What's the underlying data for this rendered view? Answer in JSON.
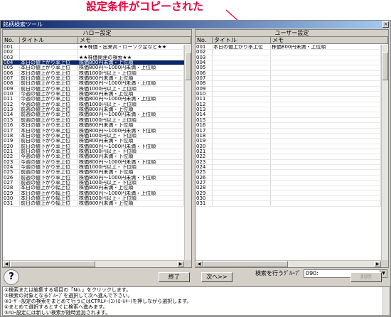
{
  "annotation": {
    "text": "設定条件がコピーされた"
  },
  "window": {
    "title": "銘柄検索ツール",
    "close_label": "×"
  },
  "left_pane": {
    "caption": "ハロー設定",
    "headers": {
      "no": "No.",
      "title": "タイトル",
      "memo": "メモ"
    },
    "rows": [
      {
        "no": "001",
        "title": "",
        "memo": "★★株価・出来高・ローソク足など★★"
      },
      {
        "no": "002",
        "title": "",
        "memo": ""
      },
      {
        "no": "003",
        "title": "",
        "memo": "★★株価関連の検索★★"
      },
      {
        "no": "004",
        "title": "本日の値上がり率上位",
        "memo": "株価800円未満・上位順",
        "sel": true
      },
      {
        "no": "005",
        "title": "本日の値上がり率上位",
        "memo": "株価800円～1000円未満・上位順"
      },
      {
        "no": "006",
        "title": "本日の値上がり率上位",
        "memo": "株価1000円以上・上位順"
      },
      {
        "no": "007",
        "title": "前日の値上がり率上位",
        "memo": "株価800円未満・上位順"
      },
      {
        "no": "008",
        "title": "前日の値上がり率上位",
        "memo": "株価800円～1000円未満・上位順"
      },
      {
        "no": "009",
        "title": "前日の値上がり率上位",
        "memo": "株価1000円以上・上位順"
      },
      {
        "no": "010",
        "title": "今週の値上がり率上位",
        "memo": "株価800円未満・上位順"
      },
      {
        "no": "011",
        "title": "今週の値上がり率上位",
        "memo": "株価800円～1000円未満・上位順"
      },
      {
        "no": "012",
        "title": "今週の値上がり率上位",
        "memo": "株価1000円以上・上位順"
      },
      {
        "no": "013",
        "title": "前週の値上がり率上位",
        "memo": "株価800円未満・上位順"
      },
      {
        "no": "014",
        "title": "前週の値上がり率上位",
        "memo": "株価800円～1000円未満・上位順"
      },
      {
        "no": "015",
        "title": "前週の値上がり率上位",
        "memo": "株価1000円以上・上位順"
      },
      {
        "no": "016",
        "title": "本日の値下がり率上位",
        "memo": "株価800円未満・下位順"
      },
      {
        "no": "017",
        "title": "本日の値下がり率上位",
        "memo": "株価800円～1000円未満・下位順"
      },
      {
        "no": "018",
        "title": "本日の値下がり率上位",
        "memo": "株価1000円以上・下位順"
      },
      {
        "no": "019",
        "title": "前日の値下がり率上位",
        "memo": "株価800円未満・下位順"
      },
      {
        "no": "020",
        "title": "前日の値下がり率上位",
        "memo": "株価800円～1000円未満・下位順"
      },
      {
        "no": "021",
        "title": "前日の値下がり率上位",
        "memo": "株価1000円以上・下位順"
      },
      {
        "no": "022",
        "title": "今週の値下がり率上位",
        "memo": "株価800円未満・下位順"
      },
      {
        "no": "023",
        "title": "今週の値下がり率上位",
        "memo": "株価800円～1000円未満・下位順"
      },
      {
        "no": "024",
        "title": "今週の値下がり率上位",
        "memo": "株価1000円以上・下位順"
      },
      {
        "no": "025",
        "title": "前週の値下がり率上位",
        "memo": "株価800円未満・下位順"
      },
      {
        "no": "026",
        "title": "前週の値下がり率上位",
        "memo": "株価800円～1000円未満・下位順"
      },
      {
        "no": "027",
        "title": "前週の値下がり率上位",
        "memo": "株価1000円以上・下位順"
      },
      {
        "no": "028",
        "title": "本日の値上がり幅上位",
        "memo": "株価800円未満・上位順"
      },
      {
        "no": "029",
        "title": "本日の値上がり幅上位",
        "memo": "株価800円～1000円未満・上位順"
      },
      {
        "no": "030",
        "title": "本日の値上がり幅上位",
        "memo": "株価1000円以上・上位順"
      },
      {
        "no": "031",
        "title": "前日の値上がり幅上位",
        "memo": "株価800円未満・上位順"
      }
    ]
  },
  "right_pane": {
    "caption": "ユーザー設定",
    "headers": {
      "no": "No.",
      "title": "タイトル",
      "memo": "メモ"
    },
    "rows": [
      {
        "no": "001",
        "title": "本日の値上がり率上位",
        "memo": "株価800円未満・上位順"
      },
      {
        "no": "002",
        "title": "",
        "memo": ""
      },
      {
        "no": "003",
        "title": "",
        "memo": ""
      },
      {
        "no": "004",
        "title": "",
        "memo": ""
      },
      {
        "no": "005",
        "title": "",
        "memo": ""
      },
      {
        "no": "006",
        "title": "",
        "memo": ""
      },
      {
        "no": "007",
        "title": "",
        "memo": ""
      },
      {
        "no": "008",
        "title": "",
        "memo": ""
      },
      {
        "no": "009",
        "title": "",
        "memo": ""
      },
      {
        "no": "010",
        "title": "",
        "memo": ""
      },
      {
        "no": "011",
        "title": "",
        "memo": ""
      },
      {
        "no": "012",
        "title": "",
        "memo": ""
      },
      {
        "no": "013",
        "title": "",
        "memo": ""
      },
      {
        "no": "014",
        "title": "",
        "memo": ""
      },
      {
        "no": "015",
        "title": "",
        "memo": ""
      },
      {
        "no": "016",
        "title": "",
        "memo": ""
      },
      {
        "no": "017",
        "title": "",
        "memo": ""
      },
      {
        "no": "018",
        "title": "",
        "memo": ""
      },
      {
        "no": "019",
        "title": "",
        "memo": ""
      },
      {
        "no": "020",
        "title": "",
        "memo": ""
      },
      {
        "no": "021",
        "title": "",
        "memo": ""
      },
      {
        "no": "022",
        "title": "",
        "memo": ""
      },
      {
        "no": "023",
        "title": "",
        "memo": ""
      },
      {
        "no": "024",
        "title": "",
        "memo": ""
      },
      {
        "no": "025",
        "title": "",
        "memo": ""
      },
      {
        "no": "026",
        "title": "",
        "memo": ""
      },
      {
        "no": "027",
        "title": "",
        "memo": ""
      },
      {
        "no": "028",
        "title": "",
        "memo": ""
      },
      {
        "no": "029",
        "title": "",
        "memo": ""
      },
      {
        "no": "030",
        "title": "",
        "memo": ""
      },
      {
        "no": "031",
        "title": "",
        "memo": ""
      }
    ]
  },
  "group": {
    "label": "検索を行うｸﾞﾙｰﾌﾟ",
    "value": "090:"
  },
  "buttons": {
    "help": "?",
    "done": "終了",
    "next": "次へ>>",
    "delete": "削除"
  },
  "messages": [
    "①検索または編集する項目の「No.」をクリックします。",
    "②検索の対象となるｸﾞﾙｰﾌﾟを選択して次へ進んで下さい。",
    "③ﾕｰｻﾞｰ設定の検索をまとめて行うにはCTRLｷｰ(ｺﾝﾄﾛｰﾙｷｰ)を押しながら選択します。",
    "④まとめて選択するとすぐに検索へ進みます。",
    "⑤ﾊﾛｰ設定には新しい検索が随時追加されます。"
  ],
  "colors": {
    "annotation": "#e8003c",
    "selection": "#0a246a",
    "titlebar": "#0a246a"
  }
}
